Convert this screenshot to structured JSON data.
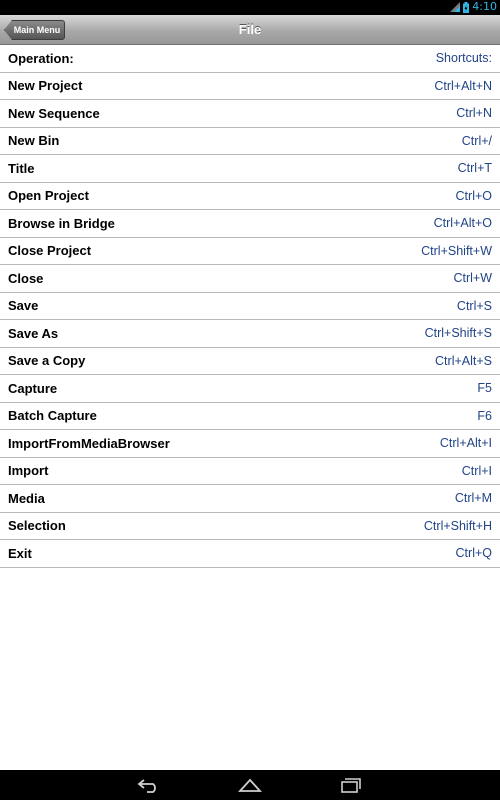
{
  "status_bar": {
    "time": "4:10"
  },
  "header": {
    "back_label": "Main Menu",
    "title": "File"
  },
  "list": {
    "header": {
      "operation": "Operation:",
      "shortcut": "Shortcuts:"
    },
    "rows": [
      {
        "operation": "New Project",
        "shortcut": "Ctrl+Alt+N"
      },
      {
        "operation": "New Sequence",
        "shortcut": "Ctrl+N"
      },
      {
        "operation": "New Bin",
        "shortcut": "Ctrl+/"
      },
      {
        "operation": "Title",
        "shortcut": "Ctrl+T"
      },
      {
        "operation": "Open Project",
        "shortcut": "Ctrl+O"
      },
      {
        "operation": "Browse in Bridge",
        "shortcut": "Ctrl+Alt+O"
      },
      {
        "operation": "Close Project",
        "shortcut": "Ctrl+Shift+W"
      },
      {
        "operation": "Close",
        "shortcut": "Ctrl+W"
      },
      {
        "operation": "Save",
        "shortcut": "Ctrl+S"
      },
      {
        "operation": "Save As",
        "shortcut": "Ctrl+Shift+S"
      },
      {
        "operation": "Save a Copy",
        "shortcut": "Ctrl+Alt+S"
      },
      {
        "operation": "Capture",
        "shortcut": "F5"
      },
      {
        "operation": "Batch Capture",
        "shortcut": "F6"
      },
      {
        "operation": "ImportFromMediaBrowser",
        "shortcut": "Ctrl+Alt+I"
      },
      {
        "operation": "Import",
        "shortcut": "Ctrl+I"
      },
      {
        "operation": "Media",
        "shortcut": "Ctrl+M"
      },
      {
        "operation": "Selection",
        "shortcut": "Ctrl+Shift+H"
      },
      {
        "operation": "Exit",
        "shortcut": "Ctrl+Q"
      }
    ]
  },
  "icons": {
    "wifi": "wifi-icon",
    "battery": "battery-icon",
    "back": "back-icon",
    "home": "home-icon",
    "recents": "recent-apps-icon"
  },
  "colors": {
    "shortcut_text": "#224488",
    "status_accent": "#33b5e5"
  }
}
